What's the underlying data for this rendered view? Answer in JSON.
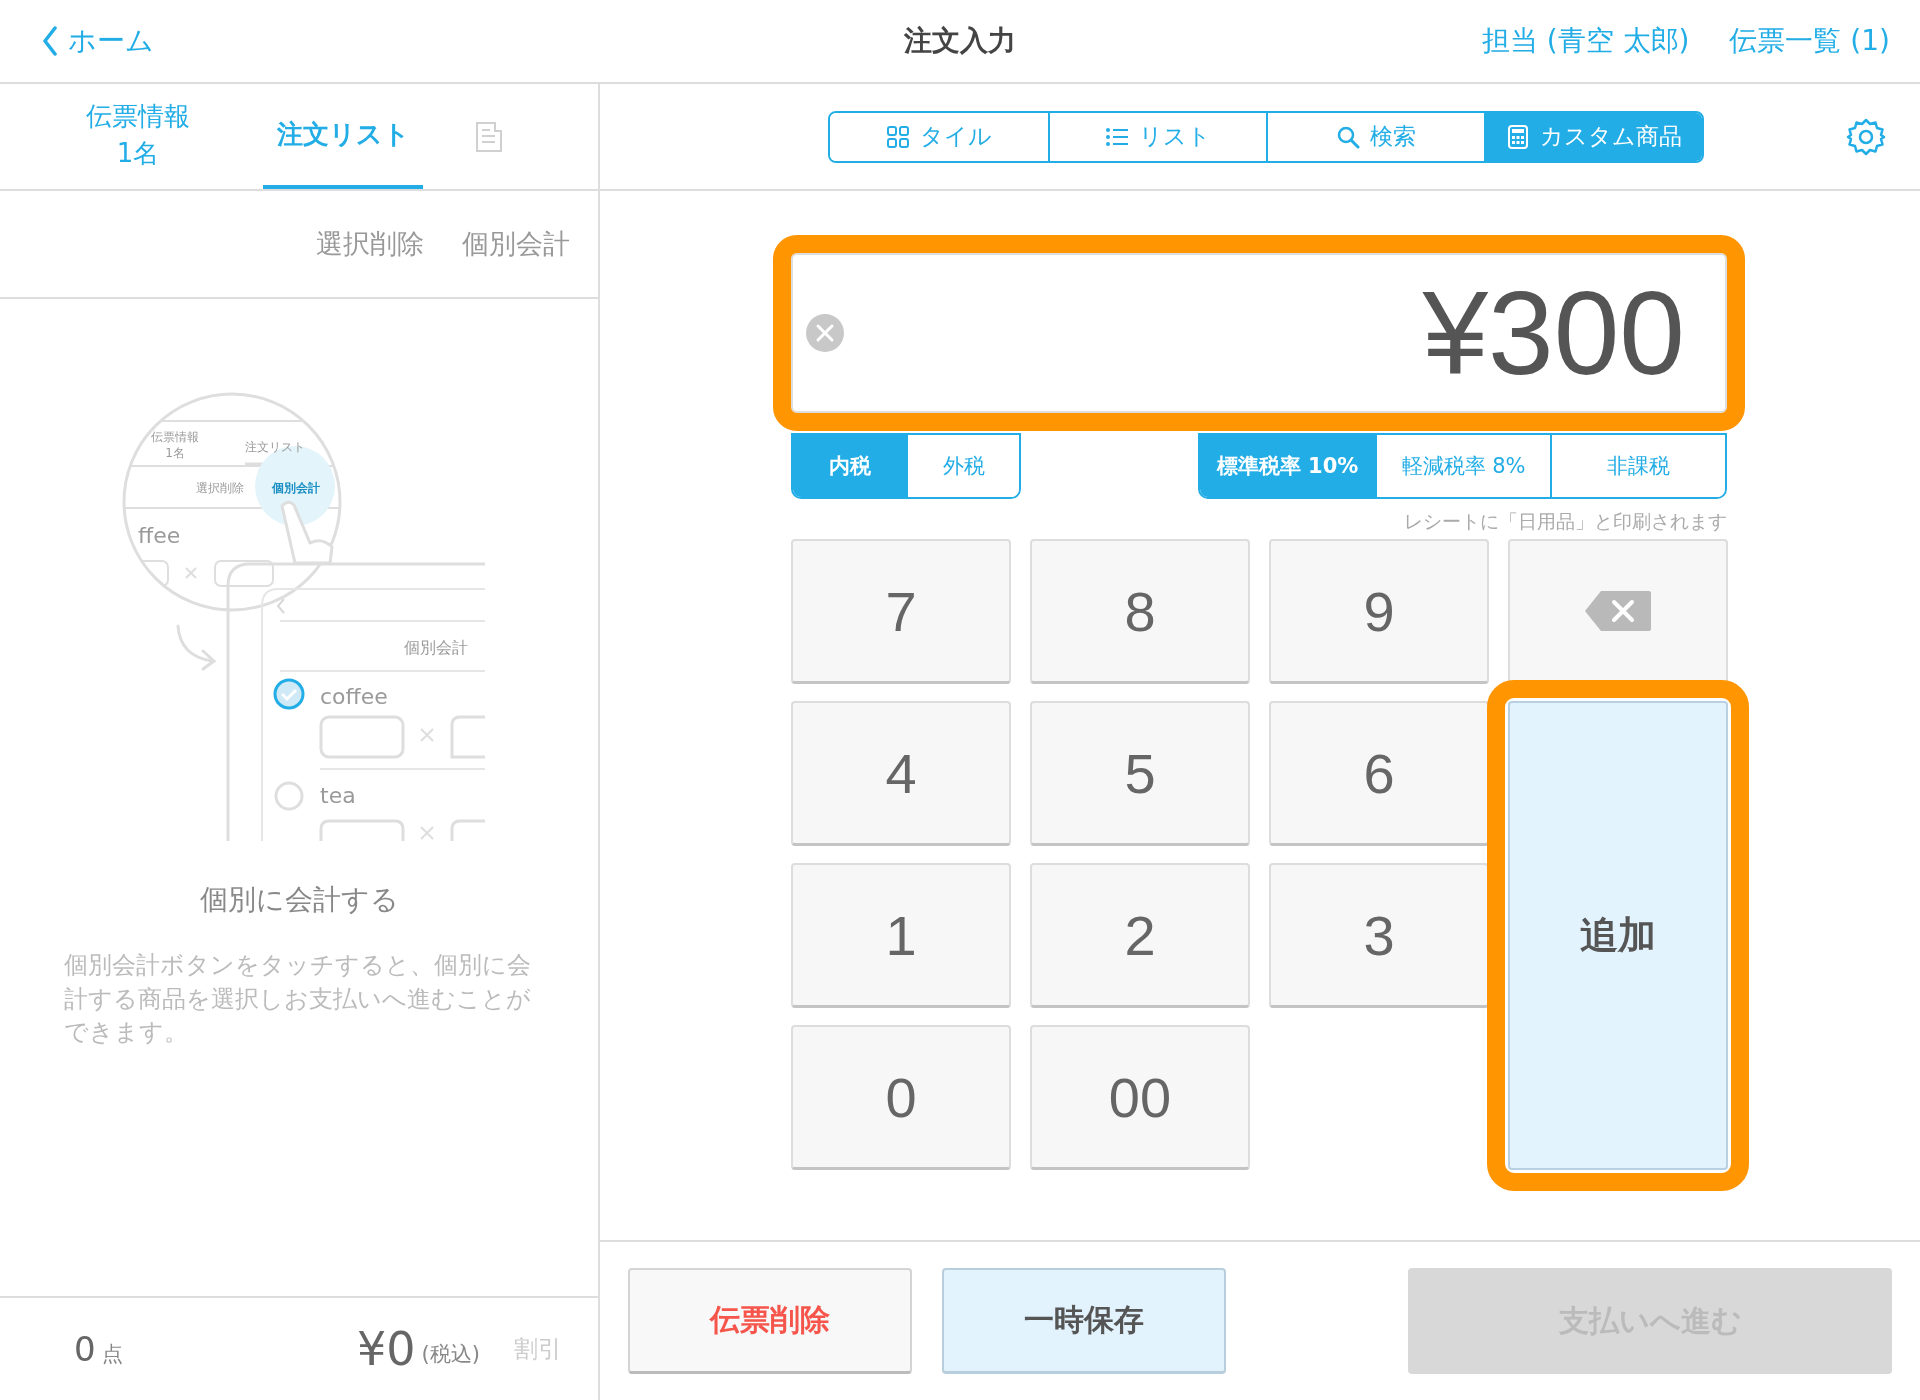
{
  "header": {
    "back": "ホーム",
    "title": "注文入力",
    "staff": "担当 (青空 太郎)",
    "slips": "伝票一覧 (1)"
  },
  "left_tabs": [
    {
      "label": "伝票情報",
      "sub": "1名",
      "selected": false
    },
    {
      "label": "注文リスト",
      "selected": true
    }
  ],
  "actions": [
    "選択削除",
    "個別会計"
  ],
  "illustration": {
    "tab_info": "伝票情報",
    "tab_info_sub": "1名",
    "tab_orders": "注文リスト",
    "zoom_delete": "選択削除",
    "zoom_split": "個別会計",
    "zoom_item": "ffee",
    "screen_split": "個別会計",
    "items": [
      {
        "name": "coffee",
        "checked": true
      },
      {
        "name": "tea",
        "checked": false
      }
    ]
  },
  "empty_title": "個別に会計する",
  "empty_text": "個別会計ボタンをタッチすると、個別に会計する商品を選択しお支払いへ進むことができます。",
  "footer": {
    "count": "0",
    "count_unit": "点",
    "total": "¥0",
    "tax_note": "(税込)",
    "discount": "割引"
  },
  "view_tabs": [
    {
      "label": "タイル",
      "kind": "tile",
      "selected": false
    },
    {
      "label": "リスト",
      "kind": "list",
      "selected": false
    },
    {
      "label": "検索",
      "kind": "search",
      "selected": false
    },
    {
      "label": "カスタム商品",
      "kind": "custom",
      "selected": true
    }
  ],
  "amount": {
    "value": "¥300",
    "highlighted": true
  },
  "tax_modes": [
    {
      "label": "内税",
      "selected": true
    },
    {
      "label": "外税",
      "selected": false
    }
  ],
  "tax_rates": [
    {
      "label": "標準税率 10%",
      "selected": true
    },
    {
      "label": "軽減税率 8%",
      "selected": false
    },
    {
      "label": "非課税",
      "selected": false
    }
  ],
  "receipt_note": "レシートに「日用品」と印刷されます",
  "keypad": [
    {
      "kind": "digit",
      "label": "7"
    },
    {
      "kind": "digit",
      "label": "8"
    },
    {
      "kind": "digit",
      "label": "9"
    },
    {
      "kind": "backspace"
    },
    {
      "kind": "digit",
      "label": "4"
    },
    {
      "kind": "digit",
      "label": "5"
    },
    {
      "kind": "digit",
      "label": "6"
    },
    {
      "kind": "digit",
      "label": "1"
    },
    {
      "kind": "digit",
      "label": "2"
    },
    {
      "kind": "digit",
      "label": "3"
    },
    {
      "kind": "digit",
      "label": "0"
    },
    {
      "kind": "digit",
      "label": "00"
    }
  ],
  "add_button": {
    "label": "追加",
    "highlighted": true
  },
  "bottom_buttons": [
    {
      "label": "伝票削除",
      "kind": "danger",
      "disabled": false
    },
    {
      "label": "一時保存",
      "kind": "save",
      "disabled": false
    },
    {
      "label": "支払いへ進む",
      "kind": "pay",
      "disabled": true
    }
  ]
}
